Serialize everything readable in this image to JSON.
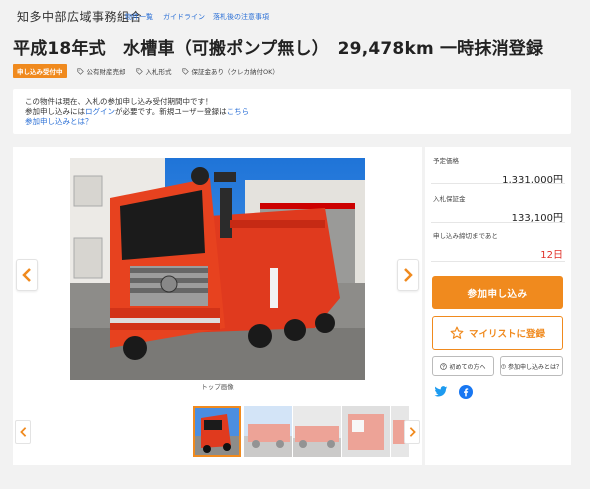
{
  "header": {
    "org_name": "知多中部広域事務組合",
    "nav": [
      {
        "label": "物件一覧"
      },
      {
        "label": "ガイドライン"
      },
      {
        "label": "落札後の注意事項"
      }
    ]
  },
  "listing": {
    "title": "平成18年式　水槽車（可搬ポンプ無し）　29,478km 一時抹消登録",
    "status_badge": "申し込み受付中",
    "tags": [
      {
        "label": "公有財産売却",
        "icon": "tag-icon"
      },
      {
        "label": "入札形式",
        "icon": "tag-icon"
      },
      {
        "label": "保証金あり（クレカ納付OK）",
        "icon": "tag-icon"
      }
    ]
  },
  "notice": {
    "line1": "この物件は現在、入札の参加申し込み受付期間中です！",
    "line2_prefix": "参加申し込みには",
    "login_link": "ログイン",
    "line2_mid": "が必要です。新規ユーザー登録は",
    "register_link": "こちら",
    "help_link": "参加申し込みとは？"
  },
  "gallery": {
    "caption": "トップ画像",
    "thumbnail_count_visible": 5
  },
  "pricing": {
    "estimated_label": "予定価格",
    "estimated_value": "1,331,000円",
    "deposit_label": "入札保証金",
    "deposit_value": "133,100円",
    "deadline_label": "申し込み締切まであと",
    "deadline_value": "12日"
  },
  "actions": {
    "apply_label": "参加申し込み",
    "favorite_label": "マイリストに登録",
    "first_time_label": "初めての方へ",
    "what_is_apply_label": "参加申し込みとは？"
  },
  "colors": {
    "accent": "#f08a1e",
    "link": "#2a6fd6",
    "deadline": "#e0312a",
    "twitter": "#1d9bf0",
    "facebook": "#1877f2"
  }
}
